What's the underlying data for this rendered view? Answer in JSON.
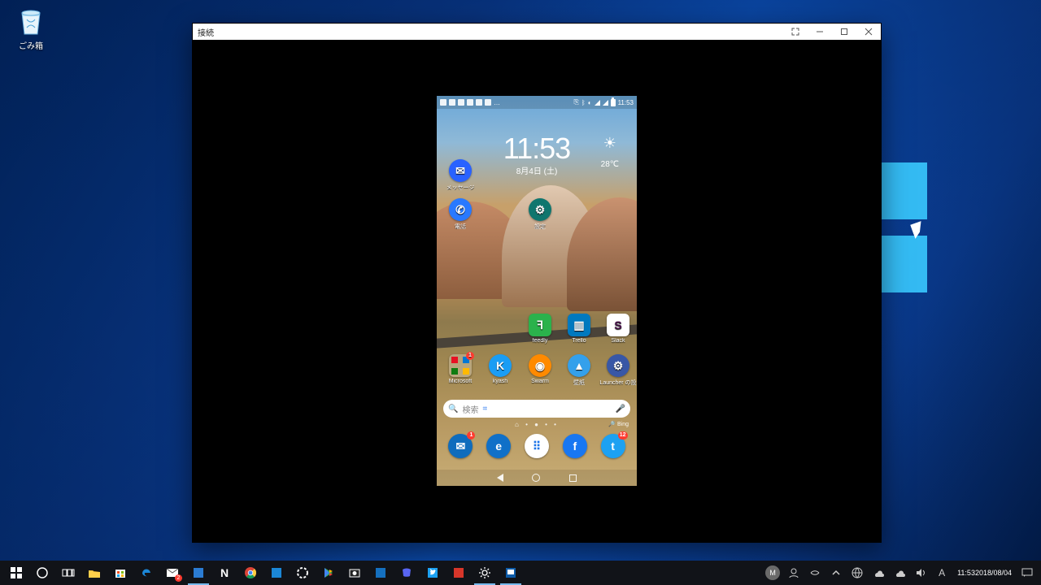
{
  "desktop": {
    "recycle_bin_label": "ごみ箱"
  },
  "window": {
    "title": "接続"
  },
  "phone": {
    "status": {
      "time": "11:53"
    },
    "clock": {
      "time": "11:53",
      "date": "8月4日 (土)"
    },
    "weather": {
      "temp": "28℃"
    },
    "left_icons": {
      "messages": "メッセージ",
      "phone": "電話",
      "settings": "設定"
    },
    "row1": {
      "feedly": "feedly",
      "trello": "Trello",
      "slack": "Slack"
    },
    "row2": {
      "microsoft": "Microsoft",
      "kyash": "kyash",
      "swarm": "Swarm",
      "wallpaper": "壁紙",
      "launcher": "Launcher の設定"
    },
    "search_placeholder": "検索",
    "bing_credit": "🔎 Bing",
    "dock": {
      "outlook_badge": "1",
      "twitter_badge": "12"
    }
  },
  "taskbar": {
    "mail_badge": "2",
    "clock_time": "11:53",
    "clock_date": "2018/08/04",
    "ime": "A"
  }
}
